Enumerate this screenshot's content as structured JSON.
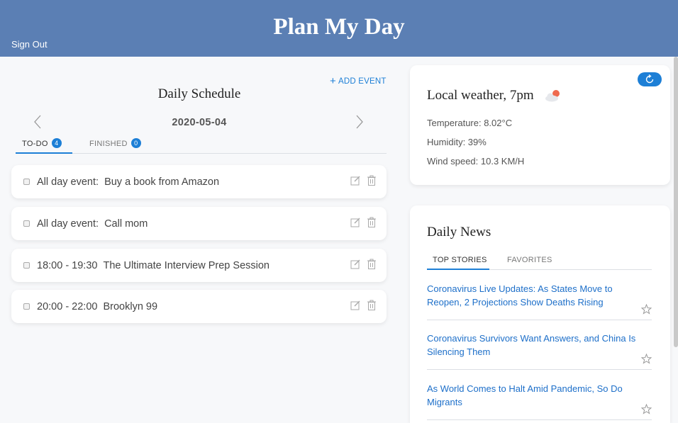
{
  "header": {
    "title": "Plan My Day",
    "sign_out": "Sign Out"
  },
  "schedule": {
    "add_event": "ADD EVENT",
    "title": "Daily Schedule",
    "date": "2020-05-04",
    "tabs": [
      {
        "label": "TO-DO",
        "count": "4",
        "active": true
      },
      {
        "label": "FINISHED",
        "count": "0",
        "active": false
      }
    ],
    "events": [
      {
        "time": "All day event:",
        "name": "Buy a book from Amazon"
      },
      {
        "time": "All day event:",
        "name": "Call mom"
      },
      {
        "time": "18:00 - 19:30",
        "name": "The Ultimate Interview Prep Session"
      },
      {
        "time": "20:00 - 22:00",
        "name": "Brooklyn 99"
      }
    ]
  },
  "weather": {
    "title": "Local weather, 7pm",
    "icon": "partly-cloudy-sun-icon",
    "temperature": "Temperature: 8.02°C",
    "humidity": "Humidity: 39%",
    "wind": "Wind speed: 10.3 KM/H"
  },
  "news": {
    "title": "Daily News",
    "tabs": [
      {
        "label": "TOP STORIES",
        "active": true
      },
      {
        "label": "FAVORITES",
        "active": false
      }
    ],
    "articles": [
      {
        "title": "Coronavirus Live Updates: As States Move to Reopen, 2 Projections Show Deaths Rising"
      },
      {
        "title": "Coronavirus Survivors Want Answers, and China Is Silencing Them"
      },
      {
        "title": "As World Comes to Halt Amid Pandemic, So Do Migrants"
      }
    ]
  },
  "colors": {
    "header": "#5b7fb4",
    "accent": "#1d7fd6",
    "link": "#1d6fc9"
  }
}
